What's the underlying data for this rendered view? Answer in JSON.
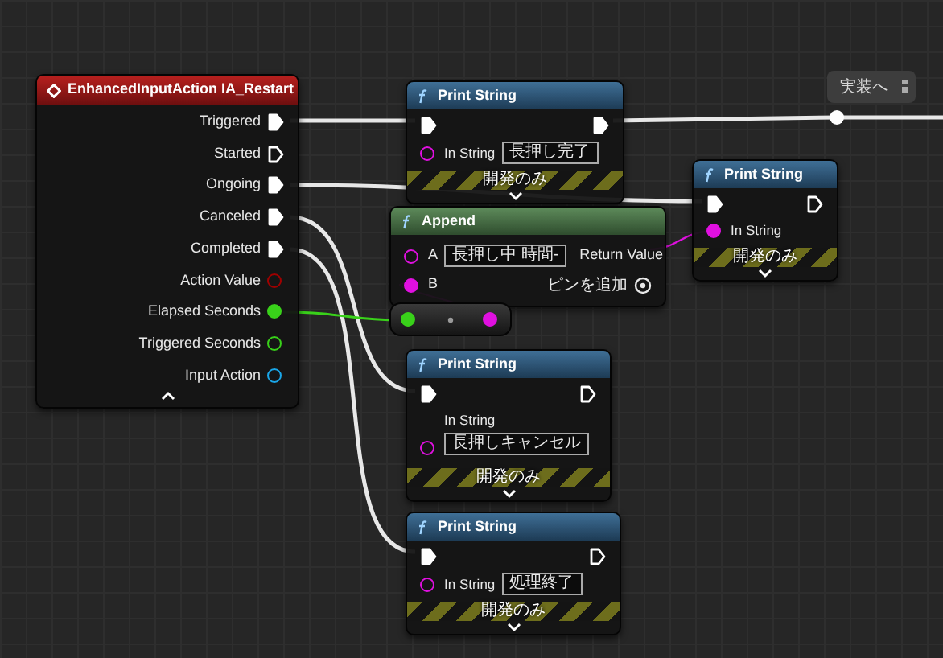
{
  "event_node": {
    "title": "EnhancedInputAction IA_Restart",
    "pins": [
      {
        "label": "Triggered",
        "kind": "exec",
        "connected": true
      },
      {
        "label": "Started",
        "kind": "exec",
        "connected": false
      },
      {
        "label": "Ongoing",
        "kind": "exec",
        "connected": true
      },
      {
        "label": "Canceled",
        "kind": "exec",
        "connected": true
      },
      {
        "label": "Completed",
        "kind": "exec",
        "connected": true
      },
      {
        "label": "Action Value",
        "kind": "data",
        "connected": false,
        "color": "#a00000"
      },
      {
        "label": "Elapsed Seconds",
        "kind": "data",
        "connected": true,
        "color": "#39d11a"
      },
      {
        "label": "Triggered Seconds",
        "kind": "data",
        "connected": false,
        "color": "#39d11a"
      },
      {
        "label": "Input Action",
        "kind": "data",
        "connected": false,
        "color": "#1aa6e8"
      }
    ]
  },
  "print_nodes": [
    {
      "title": "Print String",
      "exec_out_connected": true,
      "in_string_label": "In String",
      "in_string_connected": false,
      "kind": "inline",
      "value": "長押し完了",
      "dev_label": "開発のみ"
    },
    {
      "title": "Print String",
      "exec_out_connected": false,
      "in_string_label": "In String",
      "in_string_connected": true,
      "kind": "inline",
      "dev_label": "開発のみ"
    },
    {
      "title": "Print String",
      "exec_out_connected": false,
      "in_string_label": "In String",
      "in_string_connected": false,
      "kind": "stacked",
      "value": "長押しキャンセル",
      "dev_label": "開発のみ"
    },
    {
      "title": "Print String",
      "exec_out_connected": false,
      "in_string_label": "In String",
      "in_string_connected": false,
      "kind": "inline",
      "value": "処理終了",
      "dev_label": "開発のみ"
    }
  ],
  "append_node": {
    "title": "Append",
    "pin_a": {
      "label": "A",
      "value": "長押し中 時間-",
      "connected": false
    },
    "pin_b": {
      "label": "B",
      "connected": true
    },
    "return_label": "Return Value",
    "add_pin_label": "ピンを追加"
  },
  "reroute": {
    "comment": "実装へ"
  }
}
